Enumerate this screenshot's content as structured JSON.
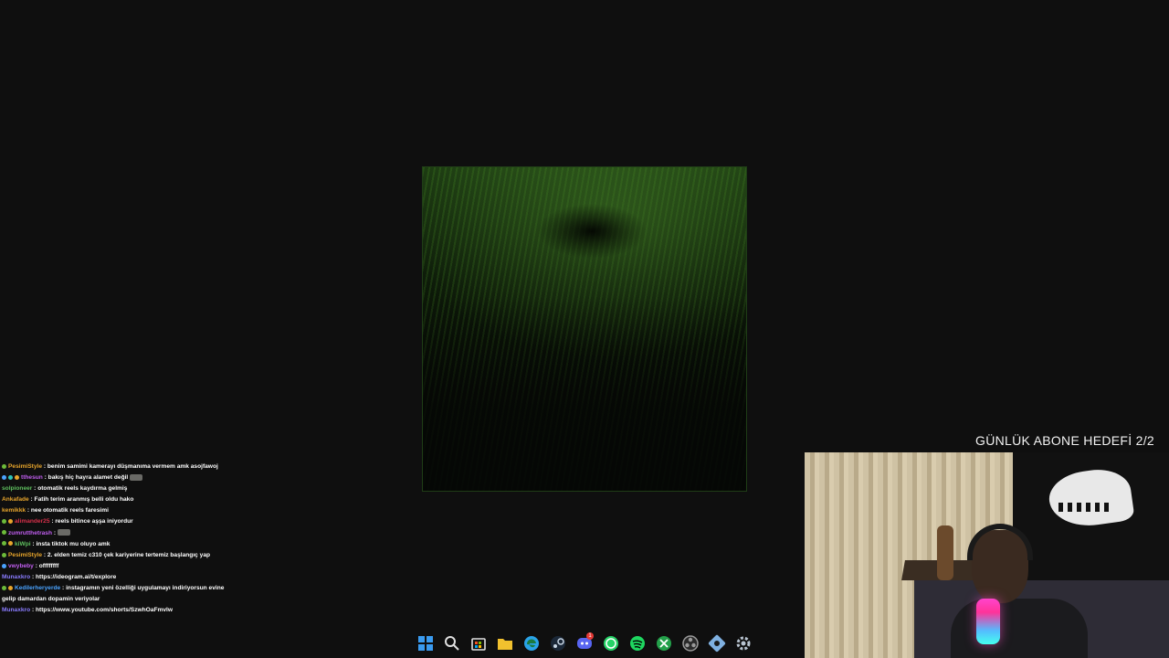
{
  "overlay": {
    "goal_text": "GÜNLÜK ABONE HEDEFİ 2/2"
  },
  "chat": {
    "messages": [
      {
        "badges": [
          "green"
        ],
        "user": "PesimiStyle",
        "user_color": "#e7a52c",
        "text": ": benim samimi kamerayı düşmanıma vermem amk asojfawoj",
        "emote": false
      },
      {
        "badges": [
          "blue",
          "teal",
          "orange"
        ],
        "user": "tthesun",
        "user_color": "#c15ef0",
        "text": ": bakış hiç hayra alamet değil",
        "emote": true
      },
      {
        "badges": [],
        "user": "solpioneer",
        "user_color": "#5fbf5f",
        "text": ": otomatik reels kaydırma gelmiş",
        "emote": false
      },
      {
        "badges": [],
        "user": "Ankafade",
        "user_color": "#e7a52c",
        "text": ": Fatih terim aranmış belli oldu hako",
        "emote": false
      },
      {
        "badges": [],
        "user": "kemikkk",
        "user_color": "#e7a52c",
        "text": ": nee otomatik reels faresimi",
        "emote": false
      },
      {
        "badges": [
          "green",
          "orange"
        ],
        "user": "alimander25",
        "user_color": "#d6304a",
        "text": ": reels bitince aşşa iniyordur",
        "emote": false
      },
      {
        "badges": [
          "green"
        ],
        "user": "zumrutthetrash",
        "user_color": "#c15ef0",
        "text": ":",
        "emote": true
      },
      {
        "badges": [
          "green",
          "orange"
        ],
        "user": "kiWpi",
        "user_color": "#5fbf5f",
        "text": ": insta tiktok mu oluyo amk",
        "emote": false
      },
      {
        "badges": [
          "green"
        ],
        "user": "PesimiStyle",
        "user_color": "#e7a52c",
        "text": ": 2. elden temiz c310 çek kariyerine tertemiz başlangıç yap",
        "emote": false
      },
      {
        "badges": [
          "blue"
        ],
        "user": "vwybeby",
        "user_color": "#c15ef0",
        "text": ": offffffff",
        "emote": false
      },
      {
        "badges": [],
        "user": "Munaxkro",
        "user_color": "#8a7cff",
        "text": ": https://ideogram.ai/t/explore",
        "emote": false
      },
      {
        "badges": [
          "green",
          "orange"
        ],
        "user": "Kedilerheryerde",
        "user_color": "#4aa3ff",
        "text": ": instagramın yeni özelliği uygulamayı indiriyorsun evine gelip damardan dopamin veriyolar",
        "emote": false
      },
      {
        "badges": [],
        "user": "Munaxkro",
        "user_color": "#8a7cff",
        "text": ": https://www.youtube.com/shorts/SzwhOaFmvlw",
        "emote": false
      }
    ]
  },
  "taskbar": {
    "icons": [
      {
        "name": "start-icon",
        "color": "#3a9bf0"
      },
      {
        "name": "search-icon",
        "color": "#e0e0e0"
      },
      {
        "name": "store-icon",
        "color": "#e0e0e0"
      },
      {
        "name": "file-explorer-icon",
        "color": "#f2c12e"
      },
      {
        "name": "edge-icon",
        "color": "#2aa3e8"
      },
      {
        "name": "steam-icon",
        "color": "#c8d6e5"
      },
      {
        "name": "discord-icon",
        "color": "#5865f2",
        "badge": "1"
      },
      {
        "name": "whatsapp-icon",
        "color": "#25d366"
      },
      {
        "name": "spotify-icon",
        "color": "#1ed760"
      },
      {
        "name": "xbox-icon",
        "color": "#23a04a"
      },
      {
        "name": "obs-icon",
        "color": "#9a9a9a"
      },
      {
        "name": "network-tool-icon",
        "color": "#7fb0e0"
      },
      {
        "name": "settings-icon",
        "color": "#b8c4d0"
      }
    ]
  }
}
